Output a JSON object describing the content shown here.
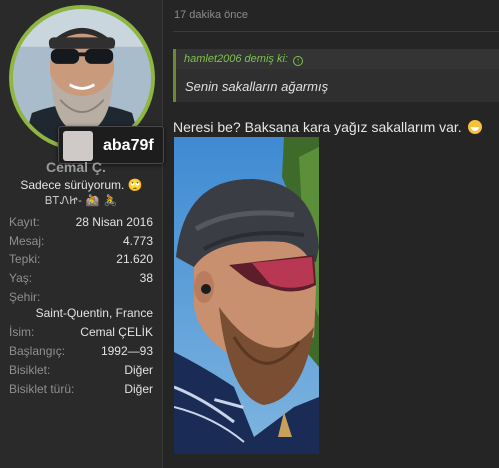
{
  "user": {
    "handle_overlay": "aba79f",
    "name": "Cemal Ç.",
    "title": "Sadece sürüyorum.",
    "title_emoji": "🙄",
    "tagline": "ᏴᎢᏁᏥ- 🚵 🚴",
    "stats": [
      {
        "label": "Kayıt:",
        "value": "28 Nisan 2016"
      },
      {
        "label": "Mesaj:",
        "value": "4.773"
      },
      {
        "label": "Tepki:",
        "value": "21.620"
      },
      {
        "label": "Yaş:",
        "value": "38"
      }
    ],
    "location_label": "Şehir:",
    "location_value": "Saint-Quentin, France",
    "details": [
      {
        "label": "İsim:",
        "value": "Cemal ÇELİK"
      },
      {
        "label": "Başlangıç:",
        "value": "1992—93"
      },
      {
        "label": "Bisiklet:",
        "value": "Diğer"
      },
      {
        "label": "Bisiklet türü:",
        "value": "Diğer"
      }
    ],
    "avatar_ring_color": "#8fb640"
  },
  "post": {
    "timestamp": "17 dakika önce",
    "quote": {
      "author_line": "hamlet2006 demiş ki:",
      "arrow_icon": "up-arrow-circle-icon",
      "text": "Senin sakalların ağarmış"
    },
    "body": "Neresi be? Baksana kara yağız sakallarım var.",
    "body_emoji": "grin-emoji"
  }
}
